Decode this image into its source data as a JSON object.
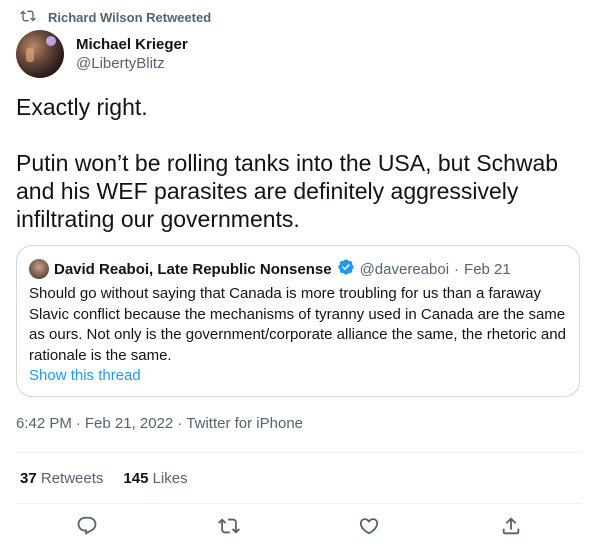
{
  "retweet_context": {
    "text": "Richard Wilson Retweeted",
    "icon": "retweet-icon"
  },
  "author": {
    "display_name": "Michael Krieger",
    "handle": "@LibertyBlitz"
  },
  "tweet": {
    "line1": "Exactly right.",
    "line2": "Putin won’t be rolling tanks into the USA, but Schwab and his WEF parasites are definitely aggressively infiltrating our governments."
  },
  "quote": {
    "display_name": "David Reaboi, Late Republic Nonsense",
    "handle": "@davereaboi",
    "dot": "·",
    "date": "Feb 21",
    "text": "Should go without saying that Canada is more troubling for us than a faraway Slavic conflict because the mechanisms of tyranny used in Canada are the same as ours. Not only is the government/corporate alliance the same, the rhetoric and rationale is the same.",
    "show_thread": "Show this thread"
  },
  "meta": {
    "time": "6:42 PM",
    "sep1": "·",
    "date": "Feb 21, 2022",
    "sep2": "·",
    "source": "Twitter for iPhone"
  },
  "stats": {
    "retweets_count": "37",
    "retweets_label": "Retweets",
    "likes_count": "145",
    "likes_label": "Likes"
  },
  "actions": [
    "reply-icon",
    "retweet-icon",
    "like-icon",
    "share-icon"
  ],
  "colors": {
    "link": "#1d9bf0",
    "secondary_text": "#536471",
    "border": "#cfd9de"
  }
}
